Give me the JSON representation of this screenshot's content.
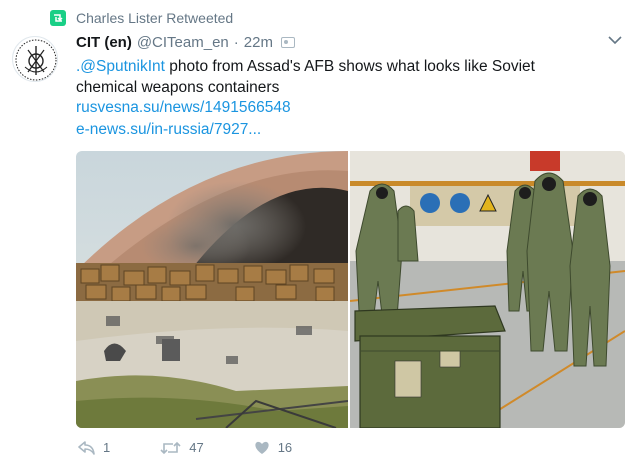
{
  "retweet_header": {
    "text": "Charles Lister Retweeted"
  },
  "tweet": {
    "author_name": "CIT (en)",
    "author_handle": "@CITeam_en",
    "separator": "·",
    "time": "22m",
    "text_mention": ".@SputnikInt",
    "text_body": " photo from Assad's AFB shows what looks like Soviet chemical weapons containers",
    "link1": "rusvesna.su/news/1491566548",
    "link2": "e-news.su/in-russia/7927..."
  },
  "actions": {
    "reply_count": "1",
    "retweet_count": "47",
    "like_count": "16"
  },
  "colors": {
    "link": "#1b95e0",
    "muted": "#657786",
    "retweet_green": "#19cf86"
  },
  "icons": [
    "retweet-icon",
    "chevron-down-icon",
    "reply-icon",
    "like-icon"
  ]
}
